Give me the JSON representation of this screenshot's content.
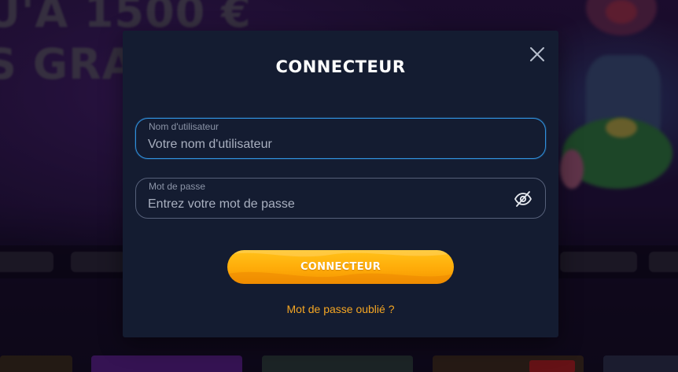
{
  "background": {
    "promo_line_1": "U'A 1500 €",
    "promo_line_2": "S GRAT"
  },
  "modal": {
    "title": "CONNECTEUR",
    "close_icon": "close-icon",
    "username": {
      "label": "Nom d'utilisateur",
      "value": "",
      "placeholder": "Votre nom d'utilisateur"
    },
    "password": {
      "label": "Mot de passe",
      "value": "",
      "placeholder": "Entrez votre mot de passe",
      "toggle_icon": "eye-off-icon"
    },
    "submit_label": "CONNECTEUR",
    "forgot_password": "Mot de passe oublié ?"
  },
  "colors": {
    "modal_background": "#141c31",
    "focus_border": "#2f8fdc",
    "button_gradient_top": "#ffc21a",
    "button_gradient_bottom": "#f59600",
    "link": "#f5a623"
  }
}
